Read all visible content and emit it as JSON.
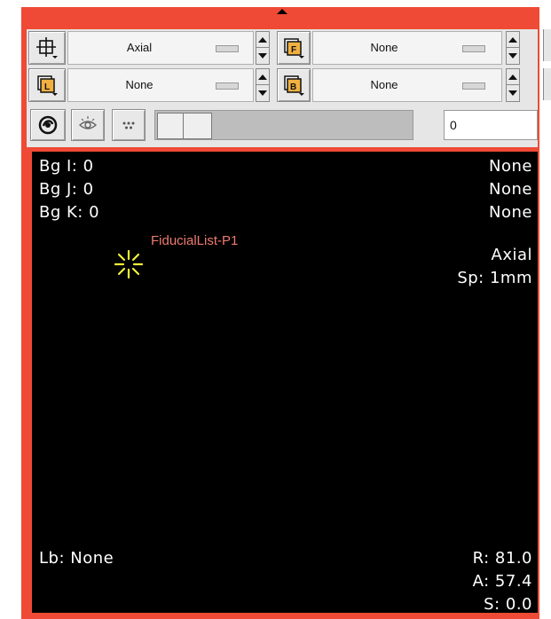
{
  "toolbar": {
    "row1": {
      "orientation_value": "Axial",
      "foreground_value": "None"
    },
    "row2": {
      "label_value": "None",
      "background_value": "None"
    },
    "row3": {
      "slice_value": "0"
    }
  },
  "icons": {
    "crosshair": "crosshair-icon",
    "foreground": "foreground-layer-icon",
    "label": "label-layer-icon",
    "background": "background-layer-icon",
    "link": "link-icon",
    "visibility": "eye-visibility-icon",
    "more": "more-options-icon"
  },
  "overlay": {
    "top_left": [
      "Bg I: 0",
      "Bg J: 0",
      "Bg K: 0"
    ],
    "top_right": [
      "None",
      "None",
      "None"
    ],
    "right_mid": [
      "Axial",
      "Sp: 1mm"
    ],
    "bottom_left": "Lb: None",
    "bottom_right": [
      "R: 81.0",
      "A: 57.4",
      "S: 0.0"
    ],
    "fiducial_label": "FiducialList-P1"
  },
  "colors": {
    "frame": "#ef4a35",
    "viewer_bg": "#000000",
    "overlay_text": "#ffffff",
    "fiducial_label": "#ef7b70",
    "fiducial_marker": "#f2f23a"
  }
}
